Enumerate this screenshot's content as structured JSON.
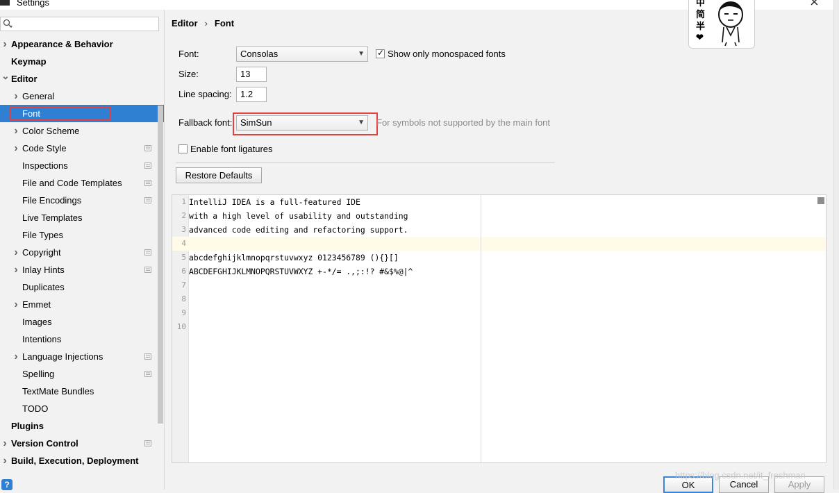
{
  "window": {
    "title": "Settings"
  },
  "search": {
    "placeholder": ""
  },
  "sidebar": {
    "items": [
      {
        "label": "Appearance & Behavior",
        "level": 0,
        "expandable": true,
        "bold": true,
        "config": false
      },
      {
        "label": "Keymap",
        "level": 0,
        "expandable": false,
        "bold": true,
        "config": false
      },
      {
        "label": "Editor",
        "level": 0,
        "expandable": true,
        "expanded": true,
        "bold": true,
        "config": false
      },
      {
        "label": "General",
        "level": 1,
        "expandable": true,
        "bold": false,
        "config": false
      },
      {
        "label": "Font",
        "level": 1,
        "expandable": false,
        "bold": false,
        "config": false,
        "selected": true
      },
      {
        "label": "Color Scheme",
        "level": 1,
        "expandable": true,
        "bold": false,
        "config": false
      },
      {
        "label": "Code Style",
        "level": 1,
        "expandable": true,
        "bold": false,
        "config": true
      },
      {
        "label": "Inspections",
        "level": 1,
        "expandable": false,
        "bold": false,
        "config": true
      },
      {
        "label": "File and Code Templates",
        "level": 1,
        "expandable": false,
        "bold": false,
        "config": true
      },
      {
        "label": "File Encodings",
        "level": 1,
        "expandable": false,
        "bold": false,
        "config": true
      },
      {
        "label": "Live Templates",
        "level": 1,
        "expandable": false,
        "bold": false,
        "config": false
      },
      {
        "label": "File Types",
        "level": 1,
        "expandable": false,
        "bold": false,
        "config": false
      },
      {
        "label": "Copyright",
        "level": 1,
        "expandable": true,
        "bold": false,
        "config": true
      },
      {
        "label": "Inlay Hints",
        "level": 1,
        "expandable": true,
        "bold": false,
        "config": true
      },
      {
        "label": "Duplicates",
        "level": 1,
        "expandable": false,
        "bold": false,
        "config": false
      },
      {
        "label": "Emmet",
        "level": 1,
        "expandable": true,
        "bold": false,
        "config": false
      },
      {
        "label": "Images",
        "level": 1,
        "expandable": false,
        "bold": false,
        "config": false
      },
      {
        "label": "Intentions",
        "level": 1,
        "expandable": false,
        "bold": false,
        "config": false
      },
      {
        "label": "Language Injections",
        "level": 1,
        "expandable": true,
        "bold": false,
        "config": true
      },
      {
        "label": "Spelling",
        "level": 1,
        "expandable": false,
        "bold": false,
        "config": true
      },
      {
        "label": "TextMate Bundles",
        "level": 1,
        "expandable": false,
        "bold": false,
        "config": false
      },
      {
        "label": "TODO",
        "level": 1,
        "expandable": false,
        "bold": false,
        "config": false
      },
      {
        "label": "Plugins",
        "level": 0,
        "expandable": false,
        "bold": true,
        "config": false
      },
      {
        "label": "Version Control",
        "level": 0,
        "expandable": true,
        "bold": true,
        "config": true
      },
      {
        "label": "Build, Execution, Deployment",
        "level": 0,
        "expandable": true,
        "bold": true,
        "config": false
      }
    ]
  },
  "breadcrumb": {
    "parent": "Editor",
    "separator": "›",
    "current": "Font"
  },
  "form": {
    "font_label": "Font:",
    "font_value": "Consolas",
    "monospaced_label": "Show only monospaced fonts",
    "monospaced_checked": true,
    "size_label": "Size:",
    "size_value": "13",
    "line_spacing_label": "Line spacing:",
    "line_spacing_value": "1.2",
    "fallback_label": "Fallback font:",
    "fallback_value": "SimSun",
    "fallback_hint": "For symbols not supported by the main font",
    "ligatures_label": "Enable font ligatures",
    "ligatures_checked": false,
    "restore_label": "Restore Defaults"
  },
  "preview": {
    "lines": [
      {
        "n": "1",
        "text": "IntelliJ IDEA is a full-featured IDE"
      },
      {
        "n": "2",
        "text": "with a high level of usability and outstanding"
      },
      {
        "n": "3",
        "text": "advanced code editing and refactoring support."
      },
      {
        "n": "4",
        "text": ""
      },
      {
        "n": "5",
        "text": "abcdefghijklmnopqrstuvwxyz 0123456789 (){}[]"
      },
      {
        "n": "6",
        "text": "ABCDEFGHIJKLMNOPQRSTUVWXYZ +-*/= .,;:!? #&$%@|^"
      },
      {
        "n": "7",
        "text": ""
      },
      {
        "n": "8",
        "text": ""
      },
      {
        "n": "9",
        "text": ""
      },
      {
        "n": "10",
        "text": ""
      }
    ]
  },
  "sticker": {
    "chars": [
      "中",
      "简",
      "半"
    ]
  },
  "footer": {
    "help_label": "?",
    "ok_label": "OK",
    "cancel_label": "Cancel",
    "apply_label": "Apply",
    "watermark": "https://blog.csdn.net/it_freshman"
  },
  "icons": {
    "search": "search-icon",
    "expand": "chevron-right-icon",
    "collapse": "chevron-down-icon",
    "config": "project-config-icon",
    "dropdown": "chevron-down-icon",
    "close": "close-icon"
  },
  "colors": {
    "selection": "#2f7fd2",
    "highlight_box": "#e43f3f",
    "current_line": "#fffbe8"
  }
}
